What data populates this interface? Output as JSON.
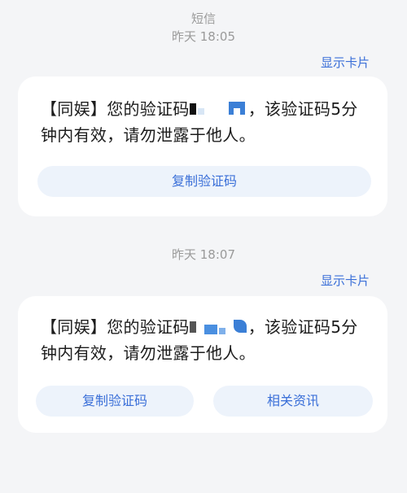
{
  "header": {
    "title": "短信"
  },
  "messages": [
    {
      "timestamp": "昨天 18:05",
      "show_card_label": "显示卡片",
      "text_before": "【同娱】您的验证码",
      "text_after": "，该验证码5分钟内有效，请勿泄露于他人。",
      "buttons": [
        "复制验证码"
      ]
    },
    {
      "timestamp": "昨天 18:07",
      "show_card_label": "显示卡片",
      "text_before": "【同娱】您的验证码",
      "text_after": "，该验证码5分钟内有效，请勿泄露于他人。",
      "buttons": [
        "复制验证码",
        "相关资讯"
      ]
    }
  ],
  "colors": {
    "accent": "#3a6fd8",
    "button_bg": "#edf3fb",
    "background": "#f4f5f7",
    "card_bg": "#ffffff"
  }
}
